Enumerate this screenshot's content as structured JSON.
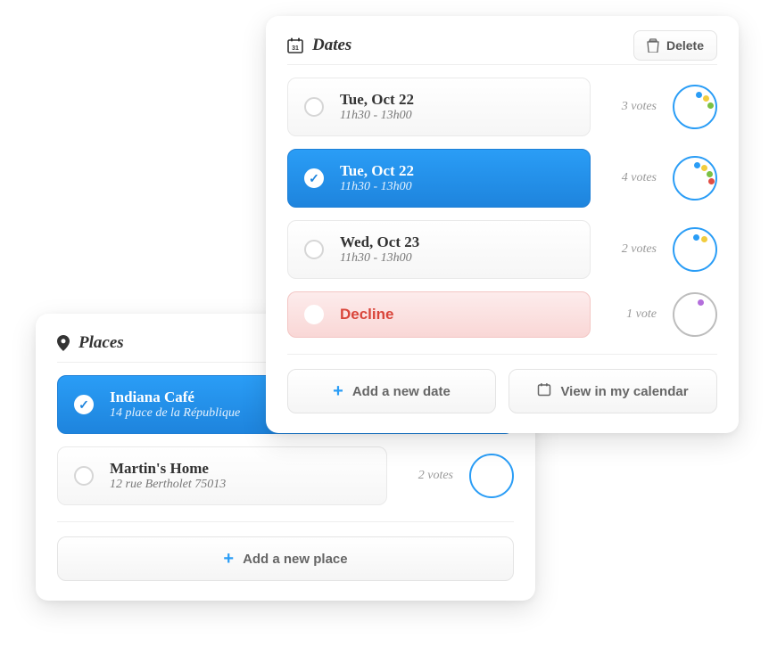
{
  "dates": {
    "title": "Dates",
    "delete_label": "Delete",
    "options": [
      {
        "date": "Tue, Oct 22",
        "time": "11h30 - 13h00",
        "votes": "3 votes"
      },
      {
        "date": "Tue, Oct 22",
        "time": "11h30 - 13h00",
        "votes": "4 votes"
      },
      {
        "date": "Wed, Oct 23",
        "time": "11h30 - 13h00",
        "votes": "2 votes"
      }
    ],
    "decline_label": "Decline",
    "decline_votes": "1 vote",
    "add_label": "Add a new date",
    "view_label": "View in my calendar"
  },
  "places": {
    "title": "Places",
    "options": [
      {
        "name": "Indiana Café",
        "addr": "14 place de la République"
      },
      {
        "name": "Martin's Home",
        "addr": "12 rue Bertholet 75013",
        "votes": "2 votes"
      }
    ],
    "add_label": "Add a new place"
  }
}
